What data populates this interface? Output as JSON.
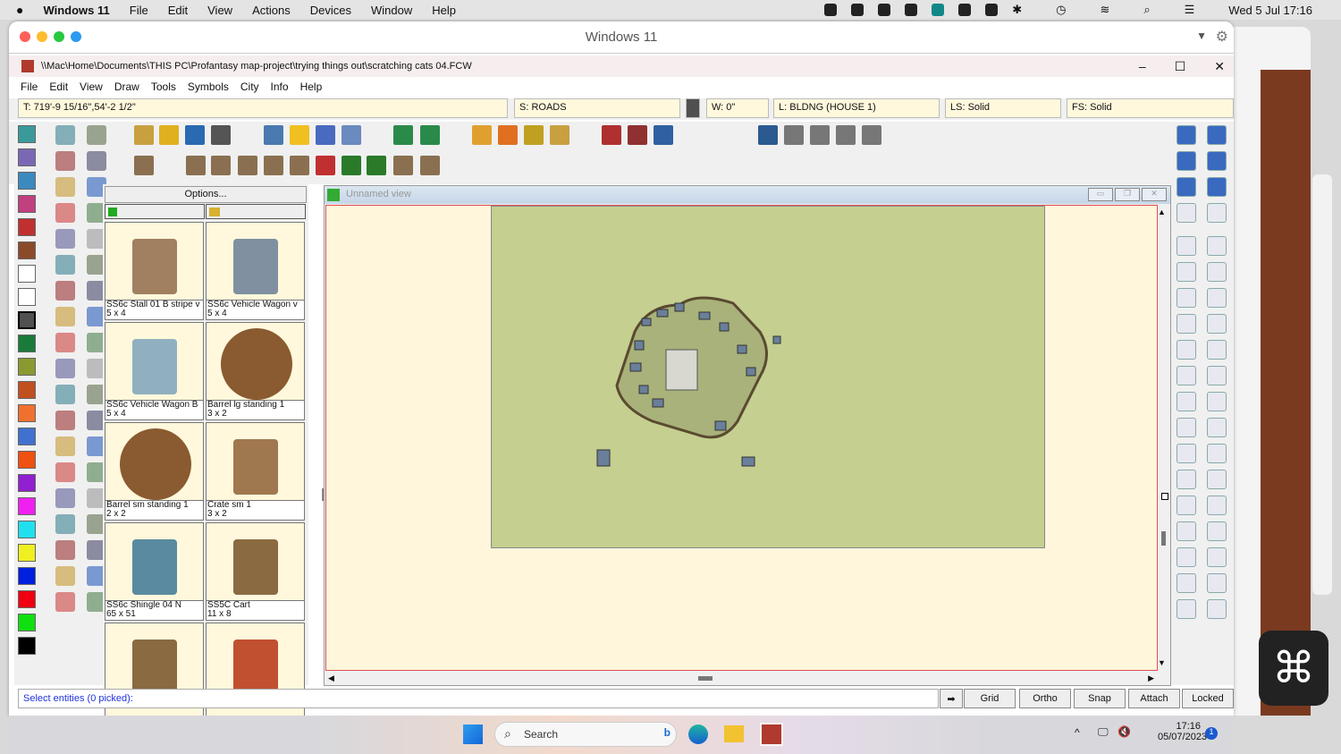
{
  "macbar": {
    "app": "Windows 11",
    "menus": [
      "File",
      "Edit",
      "View",
      "Actions",
      "Devices",
      "Window",
      "Help"
    ],
    "clock": "Wed 5 Jul  17:16"
  },
  "vm_window": {
    "title": "Windows 11"
  },
  "app": {
    "title": "\\\\Mac\\Home\\Documents\\THIS PC\\Profantasy map-project\\trying things out\\scratching cats 04.FCW",
    "menus": [
      "File",
      "Edit",
      "View",
      "Draw",
      "Tools",
      "Symbols",
      "City",
      "Info",
      "Help"
    ],
    "status": {
      "coords": "T: 719'-9 15/16\",54'-2 1/2\"",
      "sheet": "S: ROADS",
      "width": "W: 0\"",
      "layer": "L: BLDNG (HOUSE 1)",
      "line_style": "LS: Solid",
      "fill_style": "FS: Solid"
    },
    "current_color": "#505050",
    "palette": [
      "#3a9a9a",
      "#7b68b5",
      "#3a8ac0",
      "#c04080",
      "#c03030",
      "#8b4a2a",
      "#ffffff",
      "#ffffff",
      "#505050",
      "#1a7a3a",
      "#8a9a30",
      "#c05020",
      "#f07030",
      "#4070d0",
      "#f05010",
      "#9020d0",
      "#f020f0",
      "#20e0f0",
      "#f0f020",
      "#0020e0",
      "#f00010",
      "#10e010",
      "#000000"
    ]
  },
  "catalog": {
    "options_label": "Options...",
    "symbols": [
      {
        "name": "SS6c Stall 01 B stripe v",
        "size": "5 x 4"
      },
      {
        "name": "SS6c Vehicle Wagon v",
        "size": "5 x 4"
      },
      {
        "name": "SS6c Vehicle Wagon B",
        "size": "5 x 4"
      },
      {
        "name": "Barrel lg standing 1",
        "size": "3 x 2"
      },
      {
        "name": "Barrel sm standing 1",
        "size": "2 x 2"
      },
      {
        "name": "Crate sm 1",
        "size": "3 x 2"
      },
      {
        "name": "SS6c Shingle 04 N",
        "size": "65 x 51"
      },
      {
        "name": "SS5C Cart",
        "size": "11 x 8"
      },
      {
        "name": "",
        "size": ""
      },
      {
        "name": "",
        "size": ""
      }
    ]
  },
  "view": {
    "title": "Unnamed view"
  },
  "command": {
    "prompt": "Select entities (0 picked):"
  },
  "modes": [
    "Grid",
    "Ortho",
    "Snap",
    "Attach",
    "Locked"
  ],
  "taskbar": {
    "search_placeholder": "Search",
    "time": "17:16",
    "date": "05/07/2023",
    "notifications": "1"
  }
}
